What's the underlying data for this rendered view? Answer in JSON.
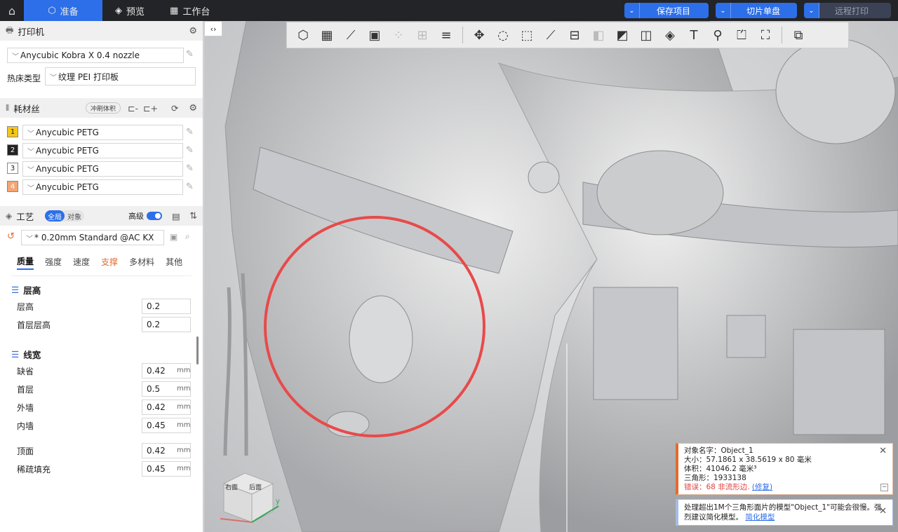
{
  "topbar": {
    "tabs": [
      {
        "label": "准备",
        "icon": "cube-icon"
      },
      {
        "label": "预览",
        "icon": "layers-icon"
      },
      {
        "label": "工作台",
        "icon": "grid-icon"
      }
    ],
    "save_project": "保存项目",
    "slice_plate": "切片单盘",
    "remote_print": "远程打印"
  },
  "printer": {
    "title": "打印机",
    "model": "Anycubic Kobra X 0.4 nozzle",
    "bed_label": "热床类型",
    "bed_type": "纹理 PEI 打印板"
  },
  "filament": {
    "title": "耗材丝",
    "flush_btn": "冲刷体积",
    "items": [
      {
        "num": "1",
        "name": "Anycubic PETG",
        "color": "#f5c518",
        "textcolor": "#222"
      },
      {
        "num": "2",
        "name": "Anycubic PETG",
        "color": "#222222",
        "textcolor": "#fff"
      },
      {
        "num": "3",
        "name": "Anycubic PETG",
        "color": "#ffffff",
        "textcolor": "#222"
      },
      {
        "num": "4",
        "name": "Anycubic PETG",
        "color": "#f4a574",
        "textcolor": "#fff"
      }
    ]
  },
  "process": {
    "title": "工艺",
    "scope_global": "全局",
    "scope_object": "对象",
    "advanced": "高级",
    "preset": "* 0.20mm Standard @AC KX",
    "subtabs": [
      "质量",
      "强度",
      "速度",
      "支撑",
      "多材料",
      "其他"
    ],
    "layer_height_group": "层高",
    "layer_rows": [
      {
        "label": "层高",
        "value": "0.2",
        "unit": ""
      },
      {
        "label": "首层层高",
        "value": "0.2",
        "unit": ""
      }
    ],
    "line_width_group": "线宽",
    "line_rows": [
      {
        "label": "缺省",
        "value": "0.42",
        "unit": "mm"
      },
      {
        "label": "首层",
        "value": "0.5",
        "unit": "mm"
      },
      {
        "label": "外墙",
        "value": "0.42",
        "unit": "mm"
      },
      {
        "label": "内墙",
        "value": "0.45",
        "unit": "mm"
      }
    ],
    "extra_rows": [
      {
        "label": "顶面",
        "value": "0.42",
        "unit": "mm"
      },
      {
        "label": "稀疏填充",
        "value": "0.45",
        "unit": "mm"
      }
    ]
  },
  "viewport": {
    "cube_left": "右面",
    "cube_right": "后面",
    "axis_y": "y"
  },
  "notice_warn": {
    "line1": "对象名字：Object_1",
    "line2": "大小：57.1861 x 38.5619 x 80 毫米",
    "line3": "体积：41046.2 毫米³",
    "line4": "三角形：1933138",
    "err_text": "错误：68 非流形边.",
    "repair": "(修复)"
  },
  "notice_info": {
    "text": "处理超出1M个三角形面片的模型\"Object_1\"可能会很慢。强烈建议简化模型。",
    "link": "简化模型"
  }
}
